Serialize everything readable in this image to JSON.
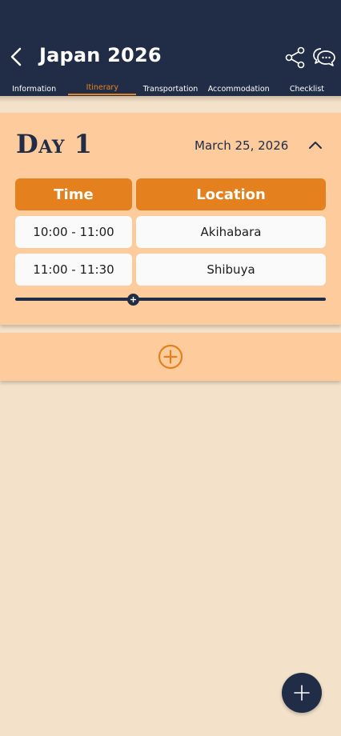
{
  "header": {
    "title": "Japan 2026",
    "tabs": [
      {
        "label": "Information",
        "active": false
      },
      {
        "label": "Itinerary",
        "active": true
      },
      {
        "label": "Transportation",
        "active": false
      },
      {
        "label": "Accommodation",
        "active": false
      },
      {
        "label": "Checklist",
        "active": false
      }
    ]
  },
  "day": {
    "title": "Day 1",
    "date": "March 25, 2026",
    "columns": [
      "Time",
      "Location"
    ],
    "rows": [
      {
        "time": "10:00 - 11:00",
        "location": "Akihabara"
      },
      {
        "time": "11:00 - 11:30",
        "location": "Shibuya"
      }
    ],
    "slider_position_fraction": 0.38
  },
  "colors": {
    "header_bg": "#212c46",
    "accent": "#e5801f",
    "card_bg": "#fecb9c",
    "page_bg": "#f3e2c9"
  },
  "icons": {
    "back": "chevron-left-icon",
    "share": "share-icon",
    "chat": "chat-bubbles-icon",
    "collapse": "chevron-up-icon",
    "add_day": "plus-circle-icon",
    "fab": "plus-icon"
  }
}
